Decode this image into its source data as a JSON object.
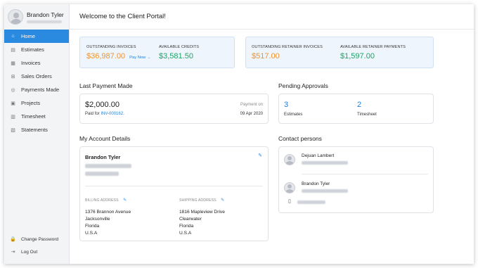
{
  "profile": {
    "name": "Brandon Tyler"
  },
  "sidebar": {
    "items": [
      {
        "label": "Home",
        "icon": "home-icon",
        "glyph": "⌂",
        "active": true
      },
      {
        "label": "Estimates",
        "icon": "document-icon",
        "glyph": "▤"
      },
      {
        "label": "Invoices",
        "icon": "invoice-icon",
        "glyph": "▦"
      },
      {
        "label": "Sales Orders",
        "icon": "cart-icon",
        "glyph": "⊞"
      },
      {
        "label": "Payments Made",
        "icon": "payment-icon",
        "glyph": "◎"
      },
      {
        "label": "Projects",
        "icon": "briefcase-icon",
        "glyph": "▣"
      },
      {
        "label": "Timesheet",
        "icon": "calendar-icon",
        "glyph": "▥"
      },
      {
        "label": "Statements",
        "icon": "statement-icon",
        "glyph": "▧"
      }
    ],
    "bottom": [
      {
        "label": "Change Password",
        "icon": "lock-icon",
        "glyph": "🔒"
      },
      {
        "label": "Log Out",
        "icon": "logout-icon",
        "glyph": "⇥"
      }
    ]
  },
  "header": {
    "title": "Welcome to the Client Portal!"
  },
  "summary_left": {
    "outstanding_label": "OUTSTANDING INVOICES",
    "outstanding_value": "$36,987.00",
    "pay_now": "Pay Now →",
    "credits_label": "AVAILABLE CREDITS",
    "credits_value": "$3,581.50"
  },
  "summary_right": {
    "retainer_label": "OUTSTANDING RETAINER INVOICES",
    "retainer_value": "$517.00",
    "retainer_payments_label": "AVAILABLE RETAINER PAYMENTS",
    "retainer_payments_value": "$1,597.00"
  },
  "last_payment": {
    "title": "Last Payment Made",
    "amount": "$2,000.00",
    "paid_for_prefix": "Paid for",
    "invoice": "INV-000162",
    "paid_on_label": "Payment on",
    "paid_on_date": "09 Apr 2020"
  },
  "pending": {
    "title": "Pending Approvals",
    "estimates_count": "3",
    "estimates_label": "Estimates",
    "timesheet_count": "2",
    "timesheet_label": "Timesheet"
  },
  "account": {
    "title": "My Account Details",
    "name": "Brandon Tyler",
    "billing_label": "BILLING ADDRESS",
    "billing_lines": [
      "1376 Brannon Avenue",
      "Jacksonville",
      "Florida",
      "U.S.A"
    ],
    "shipping_label": "SHIPPING ADDRESS",
    "shipping_lines": [
      "1816 Mapleview Drive",
      "Clearwater",
      "Florida",
      "U.S.A"
    ]
  },
  "contacts": {
    "title": "Contact persons",
    "people": [
      {
        "name": "Dejuan Lambert"
      },
      {
        "name": "Brandon Tyler"
      }
    ]
  },
  "colors": {
    "accent": "#2a8ae0",
    "orange": "#f0932b",
    "green": "#21a366",
    "panel_blue": "#eef5fd"
  }
}
